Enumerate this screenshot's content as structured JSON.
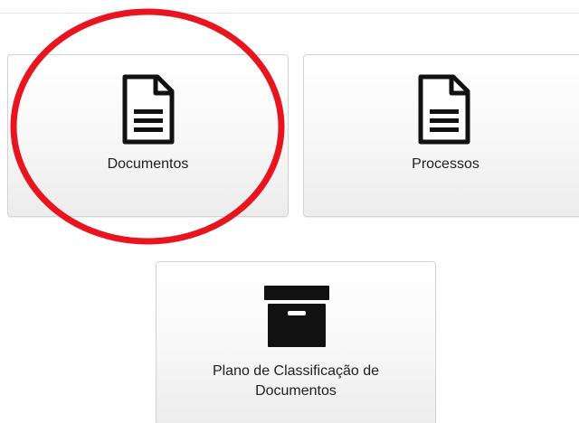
{
  "tiles": [
    {
      "label": "Documentos",
      "icon": "document-icon"
    },
    {
      "label": "Processos",
      "icon": "document-icon"
    },
    {
      "label": "Plano de Classificação de Documentos",
      "icon": "archive-box-icon"
    }
  ],
  "annotation": {
    "shape": "circle",
    "color": "#e8151f",
    "target": "Documentos"
  },
  "colors": {
    "icon": "#111111",
    "label": "#1f1f1f",
    "tile_border": "#d2d2d2"
  }
}
